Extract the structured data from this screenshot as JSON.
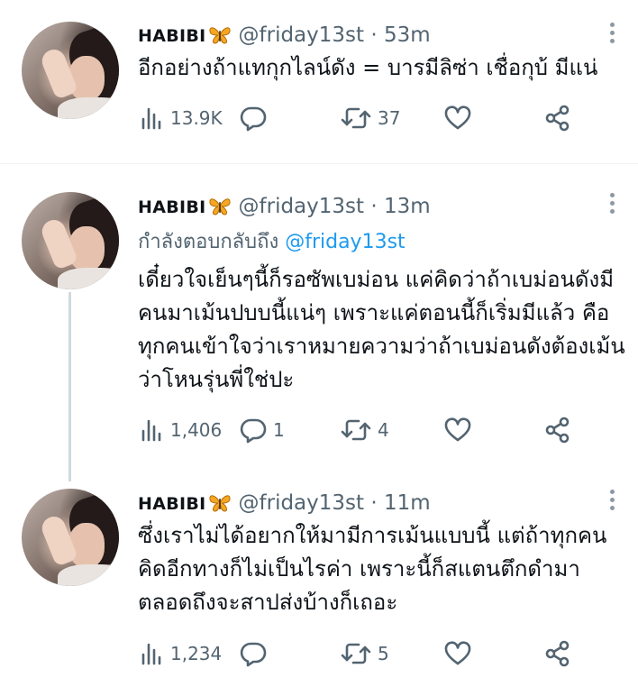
{
  "colors": {
    "text": "#0f1419",
    "secondary": "#536471",
    "link": "#1d9bf0",
    "divider": "#eff3f4",
    "butterfly": "#f5a623"
  },
  "tweets": [
    {
      "display_name": "HABIBI",
      "handle": "@friday13st",
      "time": "· 53m",
      "reply_label": "",
      "reply_mention": "",
      "text": "อีกอย่างถ้าแทกุกไลน์ดัง = บารมีลิซ่า เชื่อกุบ้ มีแน่",
      "views": "13.9K",
      "replies": "",
      "retweets": "37",
      "likes": ""
    },
    {
      "display_name": "HABIBI",
      "handle": "@friday13st",
      "time": "· 13m",
      "reply_label": "กำลังตอบกลับถึง",
      "reply_mention": "@friday13st",
      "text": "เดี๋ยวใจเย็นๆนี้ก็รอซัพเบม่อน แค่คิดว่าถ้าเบม่อนดังมีคนมาเม้นปบบนี้แน่ๆ เพราะแค่ตอนนี้ก็เริ่มมีแล้ว คือทุกคนเข้าใจว่าเราหมายความว่าถ้าเบม่อนดังต้องเม้นว่าโหนรุ่นพี่ใช่ปะ",
      "views": "1,406",
      "replies": "1",
      "retweets": "4",
      "likes": ""
    },
    {
      "display_name": "HABIBI",
      "handle": "@friday13st",
      "time": "· 11m",
      "reply_label": "",
      "reply_mention": "",
      "text": "ซึ่งเราไม่ได้อยากให้มามีการเม้นแบบนี้ แต่ถ้าทุกคนคิดอีกทางก็ไม่เป็นไรค่า เพราะนี้ก็สแตนตึกดำมาตลอดถึงจะสาปส่งบ้างก็เถอะ",
      "views": "1,234",
      "replies": "",
      "retweets": "5",
      "likes": ""
    }
  ],
  "icons": {
    "views": "bar-chart-icon",
    "reply": "speech-bubble-icon",
    "retweet": "retweet-arrows-icon",
    "like": "heart-icon",
    "share": "share-nodes-icon",
    "more": "vertical-dots-icon",
    "name_emoji": "butterfly-icon"
  }
}
